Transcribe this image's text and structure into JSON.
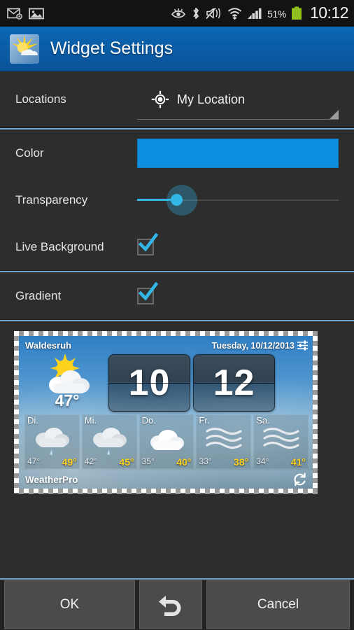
{
  "statusbar": {
    "icons_left": [
      "mail-icon",
      "gallery-icon"
    ],
    "icons_right": [
      "smart-stay-eye-icon",
      "bluetooth-icon",
      "sound-muted-icon",
      "wifi-icon",
      "cellular-signal-icon"
    ],
    "battery_percent": "51%",
    "battery_color": "#8fbf21",
    "clock": "10:12"
  },
  "header": {
    "title": "Widget Settings",
    "icon": "weather-app-icon",
    "bg_color": "#0a5ea8"
  },
  "settings": {
    "locations": {
      "label": "Locations",
      "icon": "gps-target-icon",
      "value": "My Location",
      "caret": "dropdown-caret-icon"
    },
    "color": {
      "label": "Color",
      "value": "#0d8ede"
    },
    "transparency": {
      "label": "Transparency",
      "thumb_color": "#33b5e5",
      "value_percent": 19
    },
    "live_background": {
      "label": "Live Background",
      "checked": true
    },
    "gradient": {
      "label": "Gradient",
      "checked": true
    }
  },
  "preview": {
    "city": "Waldesruh",
    "date": "Tuesday, 10/12/2013",
    "settings_icon": "widget-settings-sliders-icon",
    "current": {
      "icon": "sun-behind-cloud-icon",
      "temp": "47°"
    },
    "clock": {
      "hours": "10",
      "minutes": "12"
    },
    "forecast": [
      {
        "day": "Di.",
        "icon": "rain-cloud-icon",
        "low": "47°",
        "high": "49°"
      },
      {
        "day": "Mi.",
        "icon": "rain-cloud-icon",
        "low": "42°",
        "high": "45°"
      },
      {
        "day": "Do.",
        "icon": "cloud-icon",
        "low": "35°",
        "high": "40°"
      },
      {
        "day": "Fr.",
        "icon": "fog-icon",
        "low": "33°",
        "high": "38°"
      },
      {
        "day": "Sa.",
        "icon": "fog-icon",
        "low": "34°",
        "high": "41°"
      }
    ],
    "brand": "WeatherPro",
    "refresh_icon": "refresh-icon",
    "high_temp_color": "#ffd21e"
  },
  "buttons": {
    "ok": "OK",
    "undo_icon": "undo-arrow-icon",
    "cancel": "Cancel"
  }
}
